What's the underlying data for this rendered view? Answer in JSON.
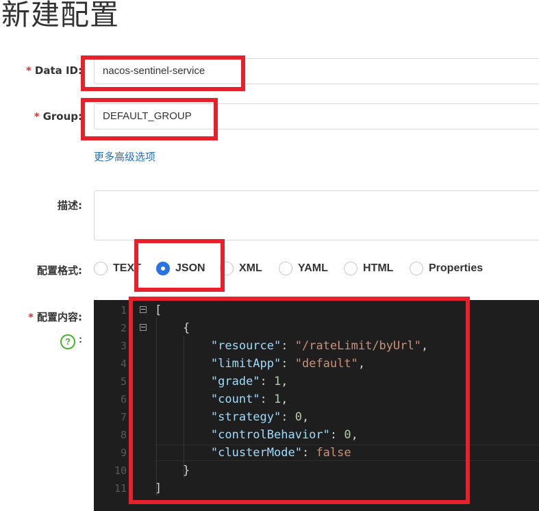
{
  "page": {
    "title": "新建配置"
  },
  "form": {
    "data_id": {
      "required_mark": "*",
      "label": "Data ID:",
      "value": "nacos-sentinel-service"
    },
    "group": {
      "required_mark": "*",
      "label": "Group:",
      "value": "DEFAULT_GROUP"
    },
    "advanced_link": "更多高级选项",
    "description": {
      "label": "描述:",
      "value": ""
    },
    "format": {
      "label": "配置格式:",
      "options": [
        "TEXT",
        "JSON",
        "XML",
        "YAML",
        "HTML",
        "Properties"
      ],
      "selected": "JSON"
    },
    "content": {
      "required_mark": "*",
      "label": "配置内容:",
      "help_icon": "question-circle-icon",
      "help_colon": ":"
    }
  },
  "editor": {
    "line_numbers": [
      "1",
      "2",
      "3",
      "4",
      "5",
      "6",
      "7",
      "8",
      "9",
      "10",
      "11"
    ],
    "fold_icon": "collapse-minus-icon",
    "lines": [
      {
        "indent": "",
        "k": "",
        "p1": "",
        "v": "",
        "p2": "["
      },
      {
        "indent": "    ",
        "k": "",
        "p1": "",
        "v": "",
        "p2": "{"
      },
      {
        "indent": "        ",
        "k": "\"resource\"",
        "p1": ": ",
        "v": "\"/rateLimit/byUrl\"",
        "vt": "s",
        "p2": ","
      },
      {
        "indent": "        ",
        "k": "\"limitApp\"",
        "p1": ": ",
        "v": "\"default\"",
        "vt": "s",
        "p2": ","
      },
      {
        "indent": "        ",
        "k": "\"grade\"",
        "p1": ": ",
        "v": "1",
        "vt": "n",
        "p2": ","
      },
      {
        "indent": "        ",
        "k": "\"count\"",
        "p1": ": ",
        "v": "1",
        "vt": "n",
        "p2": ","
      },
      {
        "indent": "        ",
        "k": "\"strategy\"",
        "p1": ": ",
        "v": "0",
        "vt": "n",
        "p2": ","
      },
      {
        "indent": "        ",
        "k": "\"controlBehavior\"",
        "p1": ": ",
        "v": "0",
        "vt": "n",
        "p2": ","
      },
      {
        "indent": "        ",
        "k": "\"clusterMode\"",
        "p1": ": ",
        "v": "false",
        "vt": "s",
        "p2": ""
      },
      {
        "indent": "    ",
        "k": "",
        "p1": "",
        "v": "",
        "p2": "}"
      },
      {
        "indent": "",
        "k": "",
        "p1": "",
        "v": "",
        "p2": "]"
      }
    ]
  },
  "colors": {
    "highlight": "#e8202a",
    "radio_selected": "#2a73e6",
    "link": "#1f6fc5",
    "required": "#e62e2e",
    "help": "#43b02a",
    "editor_bg": "#1e1e1e"
  }
}
